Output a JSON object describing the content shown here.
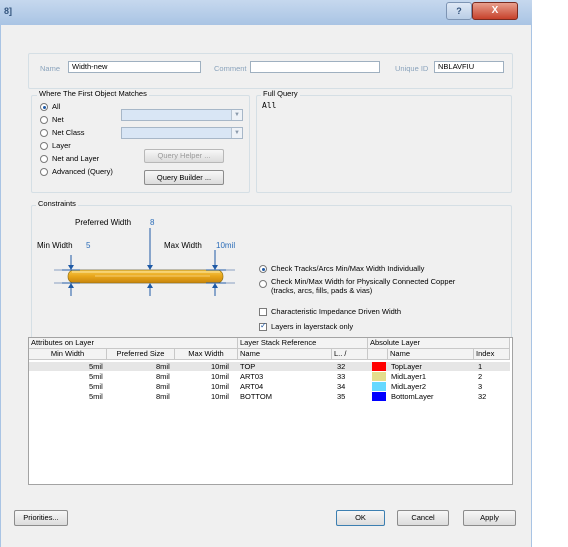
{
  "window": {
    "title_icon": "8]",
    "help_label": "?",
    "close_label": "X"
  },
  "header": {
    "name_label": "Name",
    "name_value": "Width-new",
    "comment_label": "Comment",
    "comment_value": "",
    "unique_id_label": "Unique ID",
    "unique_id_value": "NBLAVFIU"
  },
  "match": {
    "title": "Where The First Object Matches",
    "options": [
      {
        "label": "All",
        "selected": true
      },
      {
        "label": "Net",
        "selected": false
      },
      {
        "label": "Net Class",
        "selected": false
      },
      {
        "label": "Layer",
        "selected": false
      },
      {
        "label": "Net and Layer",
        "selected": false
      },
      {
        "label": "Advanced (Query)",
        "selected": false
      }
    ],
    "query_helper": "Query Helper ...",
    "query_builder": "Query Builder ..."
  },
  "full_query": {
    "title": "Full Query",
    "text": "All"
  },
  "constraints": {
    "title": "Constraints",
    "preferred_label": "Preferred Width",
    "preferred_value": "8",
    "min_label": "Min Width",
    "min_value": "5",
    "max_label": "Max Width",
    "max_value": "10mil",
    "radio1": "Check Tracks/Arcs Min/Max Width Individually",
    "radio2_line1": "Check Min/Max Width for Physically Connected Copper",
    "radio2_line2": "(tracks, arcs, fills, pads & vias)",
    "check1": "Characteristic Impedance Driven Width",
    "check2": "Layers in layerstack only",
    "check1_on": false,
    "check2_on": true
  },
  "table": {
    "group_attributes": "Attributes on Layer",
    "group_stack": "Layer Stack Reference",
    "group_absolute": "Absolute Layer",
    "col_min": "Min Width",
    "col_pref": "Preferred Size",
    "col_max": "Max Width",
    "col_name": "Name",
    "col_l": "L.. /",
    "col_absname": "Name",
    "col_index": "Index",
    "rows": [
      {
        "min": "5mil",
        "pref": "8mil",
        "max": "10mil",
        "name": "TOP",
        "l": "32",
        "absname": "TopLayer",
        "index": "1",
        "color": "#ff0000"
      },
      {
        "min": "5mil",
        "pref": "8mil",
        "max": "10mil",
        "name": "ART03",
        "l": "33",
        "absname": "MidLayer1",
        "index": "2",
        "color": "#e4dd8c"
      },
      {
        "min": "5mil",
        "pref": "8mil",
        "max": "10mil",
        "name": "ART04",
        "l": "34",
        "absname": "MidLayer2",
        "index": "3",
        "color": "#66d9ff"
      },
      {
        "min": "5mil",
        "pref": "8mil",
        "max": "10mil",
        "name": "BOTTOM",
        "l": "35",
        "absname": "BottomLayer",
        "index": "32",
        "color": "#0000ff"
      }
    ]
  },
  "footer": {
    "priorities": "Priorities...",
    "ok": "OK",
    "cancel": "Cancel",
    "apply": "Apply"
  }
}
